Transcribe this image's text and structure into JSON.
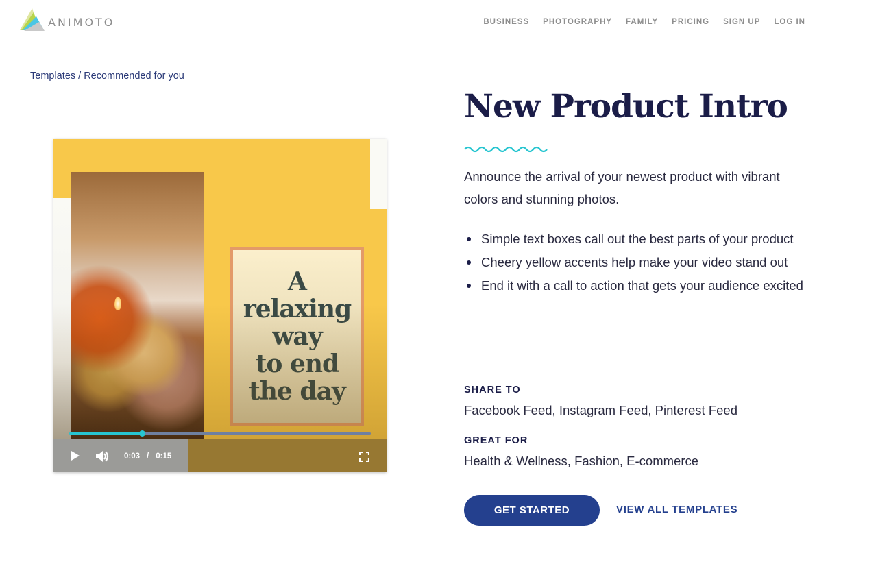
{
  "header": {
    "brand": "ANIMOTO",
    "nav": [
      {
        "label": "BUSINESS"
      },
      {
        "label": "PHOTOGRAPHY"
      },
      {
        "label": "FAMILY"
      },
      {
        "label": "PRICING"
      },
      {
        "label": "SIGN UP"
      },
      {
        "label": "LOG IN"
      }
    ]
  },
  "breadcrumb": {
    "items": [
      "Templates",
      "Recommended for you"
    ],
    "separator": " / "
  },
  "video": {
    "overlay_text": [
      "A",
      "relaxing",
      "way",
      "to end",
      "the day"
    ],
    "current_time": "0:03",
    "time_separator": "/",
    "duration": "0:15",
    "progress": 0.24,
    "icons": {
      "play": "play-icon",
      "volume": "volume-icon",
      "fullscreen": "fullscreen-icon"
    }
  },
  "template": {
    "title": "New Product Intro",
    "description": "Announce the arrival of your newest product with vibrant colors and stunning photos.",
    "features": [
      "Simple text boxes call out the best parts of your product",
      "Cheery yellow accents help make your video stand out",
      "End it with a call to action that gets your audience excited"
    ],
    "share_to_label": "SHARE TO",
    "share_to_value": "Facebook Feed, Instagram Feed, Pinterest Feed",
    "great_for_label": "GREAT FOR",
    "great_for_value": "Health & Wellness, Fashion, E-commerce"
  },
  "actions": {
    "get_started": "GET STARTED",
    "view_all": "VIEW ALL TEMPLATES"
  },
  "colors": {
    "accent_teal": "#27c5d0",
    "primary_blue": "#24408e",
    "title_navy": "#1b1d48",
    "video_yellow": "#f8c84a"
  }
}
